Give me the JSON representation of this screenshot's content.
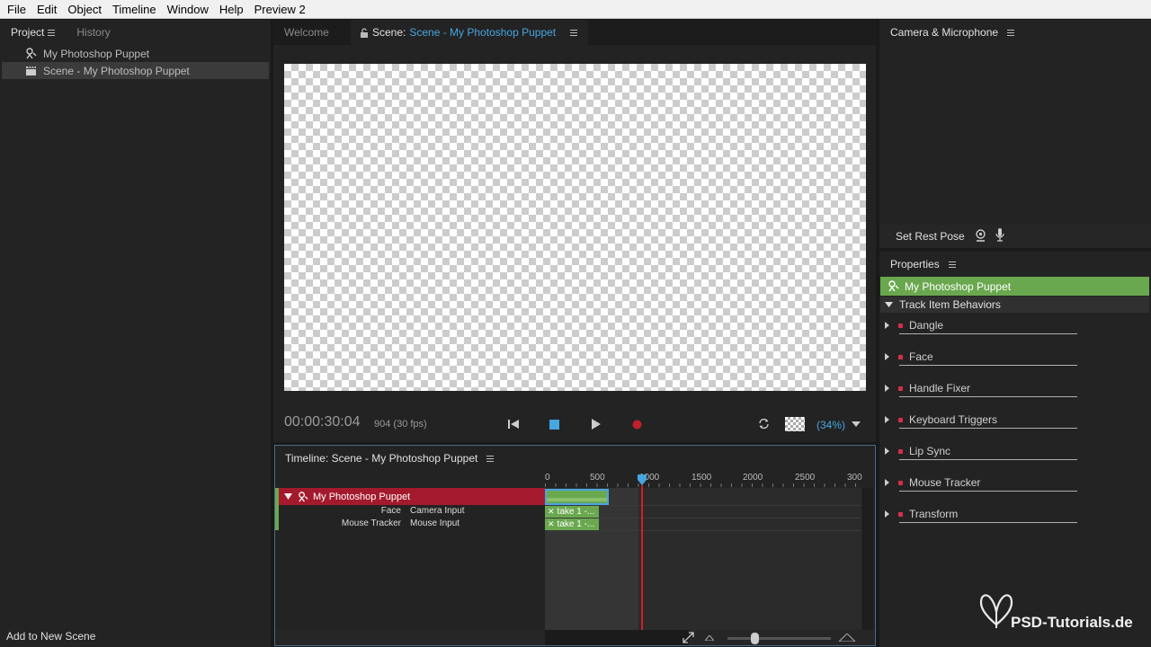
{
  "menu": [
    "File",
    "Edit",
    "Object",
    "Timeline",
    "Window",
    "Help",
    "Preview 2"
  ],
  "project_panel": {
    "tabs": [
      "Project",
      "History"
    ],
    "items": [
      "My Photoshop Puppet",
      "Scene - My Photoshop Puppet"
    ],
    "footer_button": "Add to New Scene"
  },
  "scene_panel": {
    "tabs": {
      "welcome": "Welcome",
      "scene_prefix": "Scene:",
      "scene_name": "Scene - My Photoshop Puppet"
    },
    "timecode": "00:00:30:04",
    "frames": "904 (30 fps)",
    "zoom": "(34%)"
  },
  "timeline_panel": {
    "title": "Timeline: Scene - My Photoshop Puppet",
    "ruler": [
      "0",
      "500",
      "1000",
      "1500",
      "2000",
      "2500",
      "300"
    ],
    "puppet_track": "My Photoshop Puppet",
    "rows": [
      {
        "behavior": "Face",
        "input": "Camera Input",
        "take": "take 1 -..."
      },
      {
        "behavior": "Mouse Tracker",
        "input": "Mouse Input",
        "take": "take 1 -..."
      }
    ]
  },
  "camera_panel": {
    "title": "Camera & Microphone",
    "rest_pose": "Set Rest Pose"
  },
  "properties_panel": {
    "title": "Properties",
    "selected": "My Photoshop Puppet",
    "section": "Track Item Behaviors",
    "behaviors": [
      "Dangle",
      "Face",
      "Handle Fixer",
      "Keyboard Triggers",
      "Lip Sync",
      "Mouse Tracker",
      "Transform"
    ]
  },
  "watermark": "PSD-Tutorials.de",
  "colors": {
    "accent_blue": "#46a6e0",
    "puppet_green": "#6aa84f",
    "track_red": "#a31a2c",
    "playhead": "#d0202a"
  }
}
